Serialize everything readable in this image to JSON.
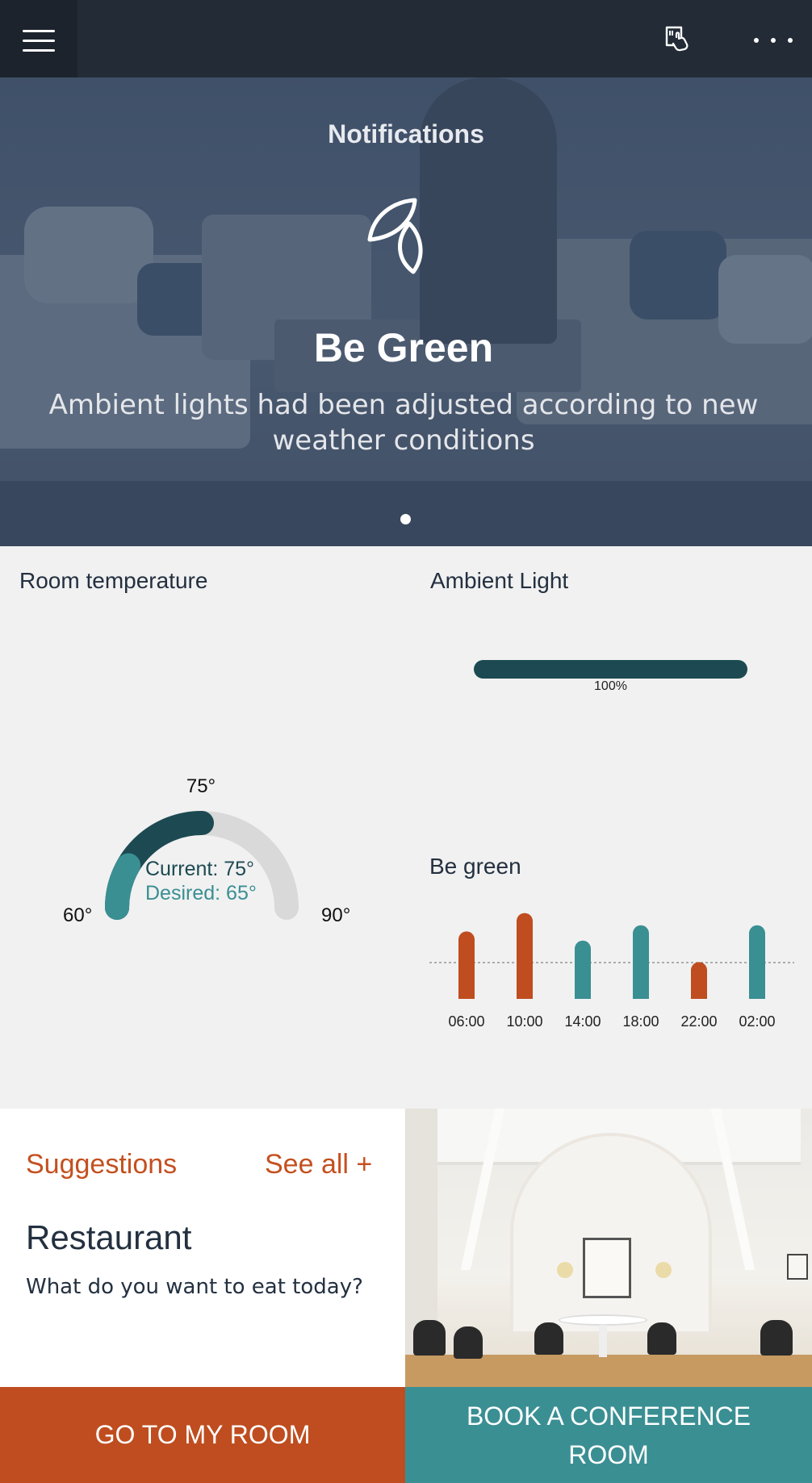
{
  "header": {
    "menu_icon": "hamburger-menu-icon",
    "card_icon": "card-tap-icon",
    "more_icon": "more-dots-icon"
  },
  "hero": {
    "heading": "Notifications",
    "icon": "leaves-icon",
    "title": "Be Green",
    "description": "Ambient lights had been adjusted according to new weather conditions"
  },
  "room_temperature": {
    "title": "Room temperature",
    "min_label": "60°",
    "max_label": "90°",
    "current_marker_label": "75°",
    "current_text": "Current: 75°",
    "desired_text": "Desired: 65°",
    "min": 60,
    "max": 90,
    "current": 75,
    "desired": 65,
    "colors": {
      "current": "#1d4a52",
      "desired": "#3a8f93",
      "track": "#d9d9d9"
    }
  },
  "ambient_light": {
    "title": "Ambient Light",
    "value_label": "100%",
    "value": 1.0
  },
  "be_green": {
    "title": "Be green",
    "chart_data": {
      "type": "bar",
      "categories": [
        "06:00",
        "10:00",
        "14:00",
        "18:00",
        "22:00",
        "02:00"
      ],
      "values": [
        2.2,
        2.8,
        1.9,
        2.4,
        1.2,
        2.4
      ],
      "direction": [
        "up",
        "up",
        "down",
        "down",
        "up",
        "down"
      ],
      "baseline": 1.35,
      "colors": {
        "up": "#bf4d1f",
        "down": "#3a8f93"
      }
    }
  },
  "suggestions": {
    "title": "Suggestions",
    "see_all": "See all +",
    "heading": "Restaurant",
    "subtitle": "What do you want to eat today?"
  },
  "buttons": {
    "go_to_room": "GO TO MY ROOM",
    "book_conference": "BOOK A CONFERENCE ROOM"
  }
}
